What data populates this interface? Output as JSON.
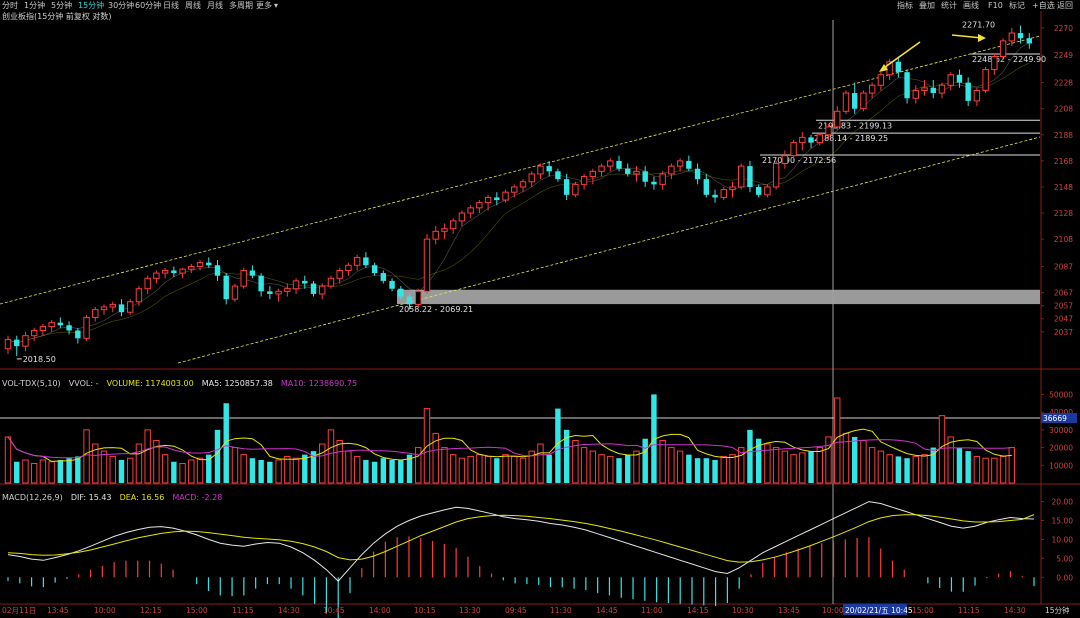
{
  "toolbar": {
    "left": [
      "分时",
      "1分钟",
      "5分钟",
      "15分钟",
      "30分钟",
      "60分钟",
      "日线",
      "周线",
      "月线",
      "多周期",
      "更多"
    ],
    "right": [
      "指标",
      "叠加",
      "统计",
      "画线",
      "F10",
      "标记",
      "+自选",
      "返回"
    ]
  },
  "main_title": "创业板指(15分钟 前复权 对数)",
  "vol_title": {
    "prefix": "VOL-TDX(5,10)",
    "vvol": "VVOL: -",
    "volume": "VOLUME: 1174003.00",
    "ma5": "MA5: 1250857.38",
    "ma10": "MA10: 1238690.75"
  },
  "macd_title": {
    "prefix": "MACD(12,26,9)",
    "dif": "DIF: 15.43",
    "dea": "DEA: 16.56",
    "macd": "MACD: -2.28"
  },
  "vol_marker": "36669",
  "period_label": "15分钟",
  "cursor_label": "20/02/21/五 10:45",
  "annotations": {
    "low": "2018.50",
    "gap": "2058.22 - 2069.21",
    "z1": "2170.90 - 2172.56",
    "z2": "2188.14 - 2189.25",
    "z3": "2193.83 - 2199.13",
    "z4": "2248.62 - 2249.90",
    "high": "2271.70"
  },
  "colors": {
    "up": "#ff3b3b",
    "down": "#33e6e6",
    "ma_white": "#e6e6e6",
    "ma_yellow": "#e6e600",
    "ma_magenta": "#cc33cc",
    "channel": "#e6e64d",
    "gap_box": "#9a9a9a",
    "arrow": "#f0e040"
  },
  "chart_data": [
    {
      "type": "candlestick",
      "title": "创业板指(15分钟 前复权 对数)",
      "y_ticks": [
        2037,
        2047,
        2057,
        2067,
        2087,
        2108,
        2128,
        2148,
        2168,
        2188,
        2208,
        2228,
        2249,
        2270
      ],
      "x_ticks": [
        "02月11日",
        "13:45",
        "10:00",
        "12:15",
        "15:00",
        "11:15",
        "14:30",
        "10:45",
        "14:00",
        "10:15",
        "13:30",
        "09:45",
        "11:30",
        "14:45",
        "11:00",
        "14:15",
        "10:30",
        "13:45",
        "10:00",
        "20/02/21/五 10:45",
        "15:00",
        "11:15",
        "14:30"
      ],
      "ohlc": [
        [
          2024,
          2034,
          2020,
          2031
        ],
        [
          2031,
          2034,
          2018.5,
          2026
        ],
        [
          2026,
          2037,
          2022,
          2034
        ],
        [
          2034,
          2040,
          2030,
          2038
        ],
        [
          2038,
          2043,
          2034,
          2041
        ],
        [
          2041,
          2046,
          2037,
          2044
        ],
        [
          2044,
          2048,
          2040,
          2042
        ],
        [
          2042,
          2045,
          2035,
          2038
        ],
        [
          2038,
          2040,
          2028,
          2032
        ],
        [
          2032,
          2050,
          2030,
          2048
        ],
        [
          2048,
          2056,
          2045,
          2054
        ],
        [
          2054,
          2058,
          2050,
          2056
        ],
        [
          2056,
          2060,
          2052,
          2058
        ],
        [
          2058,
          2062,
          2049,
          2052
        ],
        [
          2052,
          2062,
          2050,
          2060
        ],
        [
          2060,
          2072,
          2057,
          2070
        ],
        [
          2070,
          2080,
          2066,
          2078
        ],
        [
          2078,
          2084,
          2074,
          2082
        ],
        [
          2082,
          2086,
          2078,
          2084
        ],
        [
          2084,
          2087,
          2079,
          2082
        ],
        [
          2082,
          2086,
          2078,
          2085
        ],
        [
          2085,
          2089,
          2082,
          2087
        ],
        [
          2087,
          2092,
          2084,
          2090
        ],
        [
          2090,
          2094,
          2086,
          2088
        ],
        [
          2088,
          2092,
          2076,
          2080
        ],
        [
          2080,
          2082,
          2058,
          2062
        ],
        [
          2062,
          2074,
          2060,
          2072
        ],
        [
          2072,
          2086,
          2070,
          2084
        ],
        [
          2084,
          2088,
          2078,
          2080
        ],
        [
          2080,
          2082,
          2064,
          2068
        ],
        [
          2068,
          2072,
          2062,
          2066
        ],
        [
          2066,
          2070,
          2060,
          2068
        ],
        [
          2068,
          2074,
          2064,
          2070
        ],
        [
          2070,
          2078,
          2066,
          2076
        ],
        [
          2076,
          2080,
          2070,
          2074
        ],
        [
          2074,
          2076,
          2064,
          2066
        ],
        [
          2066,
          2074,
          2062,
          2072
        ],
        [
          2072,
          2080,
          2070,
          2078
        ],
        [
          2078,
          2086,
          2074,
          2084
        ],
        [
          2084,
          2090,
          2080,
          2088
        ],
        [
          2088,
          2096,
          2084,
          2094
        ],
        [
          2094,
          2098,
          2086,
          2088
        ],
        [
          2088,
          2090,
          2080,
          2082
        ],
        [
          2082,
          2084,
          2074,
          2076
        ],
        [
          2076,
          2078,
          2068,
          2070
        ],
        [
          2070,
          2072,
          2062,
          2064
        ],
        [
          2064,
          2066,
          2054,
          2058
        ],
        [
          2058,
          2070,
          2056,
          2068
        ],
        [
          2068,
          2112,
          2066,
          2108
        ],
        [
          2108,
          2118,
          2104,
          2114
        ],
        [
          2114,
          2120,
          2108,
          2116
        ],
        [
          2116,
          2124,
          2112,
          2122
        ],
        [
          2122,
          2130,
          2118,
          2128
        ],
        [
          2128,
          2134,
          2124,
          2132
        ],
        [
          2132,
          2138,
          2128,
          2136
        ],
        [
          2136,
          2142,
          2130,
          2140
        ],
        [
          2140,
          2144,
          2134,
          2138
        ],
        [
          2138,
          2146,
          2136,
          2144
        ],
        [
          2144,
          2150,
          2140,
          2148
        ],
        [
          2148,
          2154,
          2144,
          2152
        ],
        [
          2152,
          2160,
          2148,
          2158
        ],
        [
          2158,
          2166,
          2154,
          2164
        ],
        [
          2164,
          2168,
          2156,
          2160
        ],
        [
          2160,
          2162,
          2152,
          2154
        ],
        [
          2154,
          2158,
          2138,
          2142
        ],
        [
          2142,
          2152,
          2140,
          2150
        ],
        [
          2150,
          2158,
          2146,
          2156
        ],
        [
          2156,
          2162,
          2150,
          2160
        ],
        [
          2160,
          2166,
          2156,
          2164
        ],
        [
          2164,
          2170,
          2160,
          2168
        ],
        [
          2168,
          2172,
          2160,
          2162
        ],
        [
          2162,
          2166,
          2156,
          2158
        ],
        [
          2158,
          2164,
          2152,
          2160
        ],
        [
          2160,
          2164,
          2148,
          2152
        ],
        [
          2152,
          2156,
          2146,
          2150
        ],
        [
          2150,
          2160,
          2146,
          2158
        ],
        [
          2158,
          2166,
          2154,
          2164
        ],
        [
          2164,
          2170,
          2160,
          2168
        ],
        [
          2168,
          2172,
          2160,
          2162
        ],
        [
          2162,
          2166,
          2150,
          2154
        ],
        [
          2154,
          2158,
          2140,
          2142
        ],
        [
          2142,
          2146,
          2136,
          2140
        ],
        [
          2140,
          2148,
          2138,
          2146
        ],
        [
          2146,
          2152,
          2140,
          2148
        ],
        [
          2148,
          2166,
          2146,
          2164
        ],
        [
          2164,
          2168,
          2144,
          2148
        ],
        [
          2148,
          2150,
          2140,
          2142
        ],
        [
          2142,
          2150,
          2140,
          2148
        ],
        [
          2148,
          2168,
          2146,
          2166
        ],
        [
          2166,
          2176,
          2162,
          2172
        ],
        [
          2172,
          2184,
          2168,
          2182
        ],
        [
          2182,
          2190,
          2176,
          2186
        ],
        [
          2186,
          2188,
          2178,
          2182
        ],
        [
          2182,
          2190,
          2180,
          2188
        ],
        [
          2188,
          2196,
          2184,
          2194
        ],
        [
          2194,
          2210,
          2192,
          2206
        ],
        [
          2206,
          2222,
          2204,
          2220
        ],
        [
          2220,
          2228,
          2204,
          2208
        ],
        [
          2208,
          2222,
          2206,
          2220
        ],
        [
          2220,
          2228,
          2216,
          2226
        ],
        [
          2226,
          2236,
          2222,
          2234
        ],
        [
          2234,
          2246,
          2230,
          2244
        ],
        [
          2244,
          2248,
          2232,
          2236
        ],
        [
          2236,
          2238,
          2212,
          2216
        ],
        [
          2216,
          2226,
          2212,
          2222
        ],
        [
          2222,
          2230,
          2218,
          2224
        ],
        [
          2224,
          2230,
          2216,
          2220
        ],
        [
          2220,
          2228,
          2216,
          2226
        ],
        [
          2226,
          2236,
          2222,
          2234
        ],
        [
          2234,
          2238,
          2224,
          2228
        ],
        [
          2228,
          2232,
          2210,
          2214
        ],
        [
          2214,
          2224,
          2210,
          2222
        ],
        [
          2222,
          2240,
          2220,
          2238
        ],
        [
          2238,
          2250,
          2234,
          2248
        ],
        [
          2248,
          2262,
          2246,
          2260
        ],
        [
          2260,
          2270,
          2256,
          2266
        ],
        [
          2266,
          2271.7,
          2258,
          2262
        ],
        [
          2262,
          2266,
          2254,
          2258
        ]
      ],
      "gap_zone": [
        2058.22,
        2069.21
      ],
      "support_levels": [
        [
          2170.9,
          2172.56
        ],
        [
          2188.14,
          2189.25
        ],
        [
          2193.83,
          2199.13
        ],
        [
          2248.62,
          2249.9
        ]
      ]
    },
    {
      "type": "bar",
      "title": "VOL-TDX(5,10)",
      "y_ticks": [
        10000,
        20000,
        30000,
        40000,
        50000
      ],
      "reference_line": 36669,
      "values": [
        26000,
        12000,
        13000,
        11000,
        13000,
        12000,
        13000,
        14000,
        15000,
        30000,
        22000,
        18000,
        15000,
        13000,
        14000,
        22000,
        30000,
        24000,
        16000,
        12000,
        11000,
        13000,
        14000,
        16000,
        30000,
        45000,
        20000,
        16000,
        14000,
        13000,
        12000,
        13000,
        15000,
        14000,
        16000,
        18000,
        22000,
        30000,
        24000,
        18000,
        15000,
        13000,
        12000,
        14000,
        13000,
        13000,
        16000,
        20000,
        42000,
        28000,
        20000,
        16000,
        14000,
        15000,
        16000,
        15000,
        14000,
        16000,
        15000,
        14000,
        18000,
        22000,
        16000,
        42000,
        30000,
        24000,
        20000,
        18000,
        16000,
        15000,
        14000,
        16000,
        18000,
        25000,
        50000,
        24000,
        20000,
        18000,
        16000,
        14000,
        14000,
        13000,
        15000,
        16000,
        20000,
        30000,
        25000,
        22000,
        20000,
        18000,
        16000,
        17000,
        18000,
        20000,
        26000,
        48000,
        28000,
        26000,
        24000,
        20000,
        18000,
        16000,
        15000,
        14000,
        15000,
        16000,
        20000,
        38000,
        26000,
        20000,
        18000,
        15000,
        14000,
        14000,
        15000,
        20000
      ],
      "ma5": [],
      "ma10": []
    },
    {
      "type": "line",
      "title": "MACD(12,26,9)",
      "y_ticks": [
        0.0,
        5.0,
        10.0,
        15.0,
        20.0
      ],
      "series": [
        {
          "name": "DIF",
          "values": [
            6.0,
            5.5,
            4.8,
            4.5,
            5.2,
            6.0,
            7.0,
            8.2,
            9.5,
            10.8,
            11.8,
            12.6,
            13.2,
            13.4,
            13.0,
            12.2,
            11.2,
            10.0,
            9.0,
            8.5,
            8.2,
            8.8,
            9.2,
            9.0,
            8.0,
            6.5,
            4.5,
            2.0,
            -1.0,
            2.5,
            6.0,
            9.0,
            11.5,
            13.5,
            15.0,
            16.2,
            17.0,
            17.8,
            18.5,
            18.2,
            17.5,
            16.8,
            16.0,
            15.5,
            15.2,
            14.8,
            14.2,
            13.8,
            13.2,
            12.5,
            11.5,
            10.5,
            9.5,
            8.5,
            7.5,
            6.5,
            5.5,
            4.5,
            3.5,
            2.5,
            1.5,
            1.0,
            2.5,
            4.5,
            6.5,
            8.0,
            9.5,
            11.0,
            12.5,
            14.0,
            15.5,
            17.0,
            18.5,
            20.0,
            19.5,
            18.5,
            17.5,
            16.5,
            15.5,
            14.5,
            13.5,
            13.0,
            13.5,
            14.5,
            15.2,
            15.8,
            15.5,
            15.4
          ]
        },
        {
          "name": "DEA",
          "values": [
            6.5,
            6.3,
            6.0,
            5.8,
            5.9,
            6.2,
            6.6,
            7.2,
            8.0,
            8.8,
            9.6,
            10.4,
            11.0,
            11.6,
            12.0,
            12.2,
            12.1,
            11.8,
            11.4,
            11.0,
            10.6,
            10.3,
            10.1,
            9.9,
            9.5,
            8.9,
            8.0,
            6.8,
            5.2,
            4.6,
            4.8,
            5.6,
            6.8,
            8.2,
            9.6,
            11.0,
            12.2,
            13.4,
            14.6,
            15.5,
            16.0,
            16.3,
            16.4,
            16.3,
            16.1,
            15.8,
            15.5,
            15.1,
            14.7,
            14.2,
            13.6,
            12.9,
            12.2,
            11.4,
            10.6,
            9.8,
            8.9,
            8.0,
            7.1,
            6.2,
            5.3,
            4.4,
            4.0,
            4.1,
            4.6,
            5.3,
            6.2,
            7.2,
            8.3,
            9.5,
            10.7,
            12.0,
            13.3,
            14.7,
            15.7,
            16.3,
            16.5,
            16.5,
            16.3,
            15.9,
            15.4,
            14.9,
            14.6,
            14.6,
            14.7,
            15.0,
            15.3,
            16.56
          ]
        }
      ]
    }
  ]
}
